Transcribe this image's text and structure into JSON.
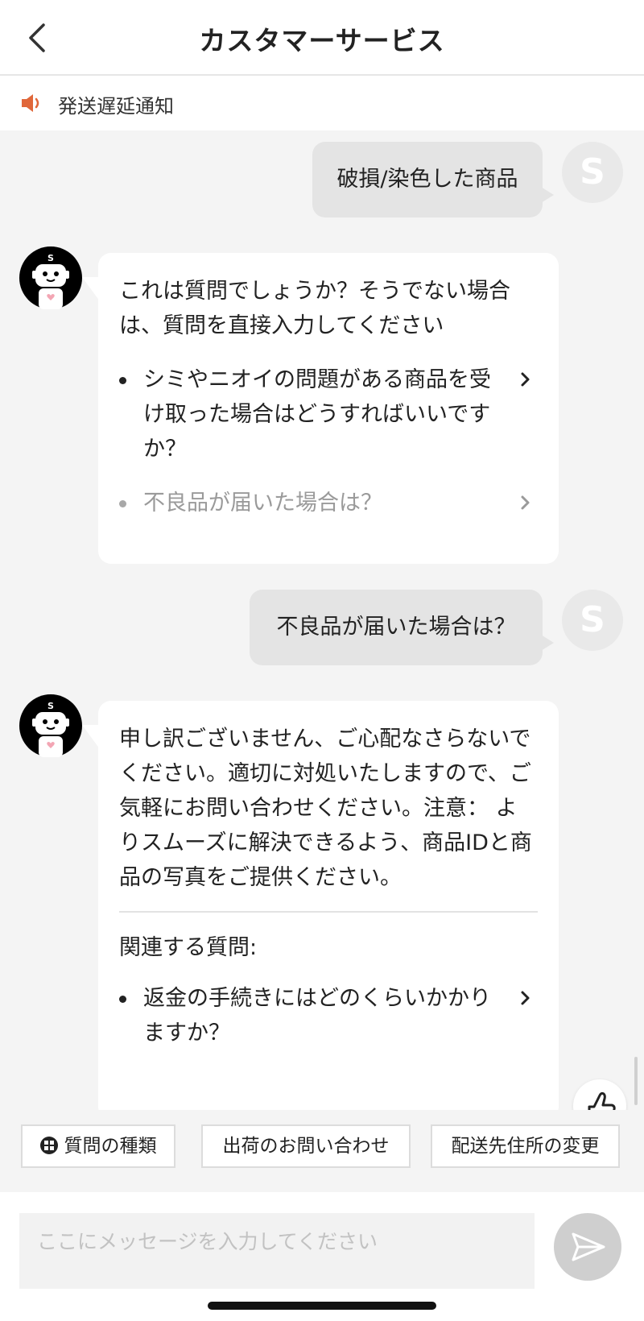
{
  "header": {
    "title": "カスタマーサービス"
  },
  "notice": {
    "text": "発送遅延通知"
  },
  "colors": {
    "accent": "#e0673a",
    "user_bubble": "#e4e4e4",
    "send_button": "#cfcfcf"
  },
  "chat": {
    "user_avatar_letter": "S",
    "messages": [
      {
        "from": "user",
        "text": "破損/染色した商品"
      },
      {
        "from": "bot",
        "intro": "これは質問でしょうか？そうでない場合は、質問を直接入力してください",
        "questions": [
          {
            "text": "シミやニオイの問題がある商品を受け取った場合はどうすればいいですか？",
            "muted": false
          },
          {
            "text": "不良品が届いた場合は？",
            "muted": true
          }
        ]
      },
      {
        "from": "user",
        "text": "不良品が届いた場合は？"
      },
      {
        "from": "bot",
        "body": "申し訳ございません、ご心配なさらないでください。適切に対処いたしますので、ご気軽にお問い合わせください。注意： よりスムーズに解決できるよう、商品IDと商品の写真をご提供ください。",
        "related_title": "関連する質問:",
        "questions": [
          {
            "text": "返金の手続きにはどのくらいかかりますか？"
          }
        ]
      }
    ]
  },
  "chips": [
    {
      "label": "質問の種類",
      "icon": "grid-icon"
    },
    {
      "label": "出荷のお問い合わせ"
    },
    {
      "label": "配送先住所の変更"
    }
  ],
  "input": {
    "placeholder": "ここにメッセージを入力してください"
  }
}
